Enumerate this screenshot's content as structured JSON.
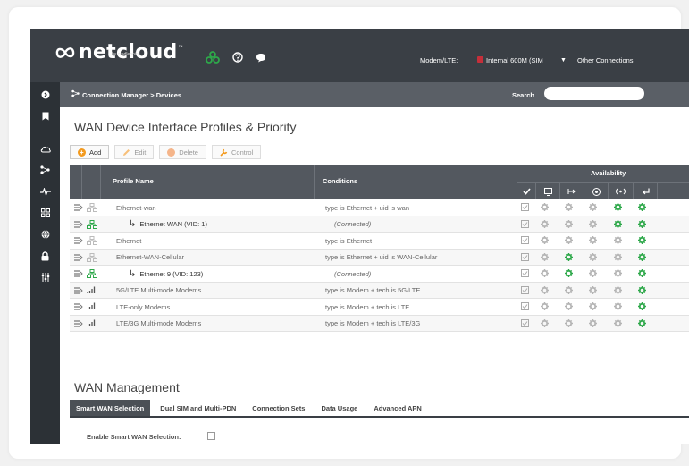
{
  "header": {
    "logo_text": "netcloud",
    "logo_tm": "™",
    "logo_by": "by cradlepoint",
    "modem_label": "Modem/LTE:",
    "modem_value": "Internal 600M (SIM",
    "other_connections": "Other Connections:"
  },
  "colors": {
    "header_bg": "#3a3f45",
    "nav_bg": "#2c3136",
    "crumb_bg": "#5a5f66",
    "accent_green": "#2ea84a",
    "add_orange": "#f39a1e"
  },
  "nav_icons": [
    "chevron-right-circle-icon",
    "bookmark-icon",
    "cloud-icon",
    "network-icon",
    "activity-icon",
    "grid-icon",
    "globe-icon",
    "lock-icon",
    "sliders-icon"
  ],
  "breadcrumb": {
    "text": "Connection Manager > Devices",
    "search_label": "Search"
  },
  "main": {
    "title": "WAN Device Interface Profiles & Priority",
    "toolbar": {
      "add": "Add",
      "edit": "Edit",
      "delete": "Delete",
      "control": "Control"
    },
    "table": {
      "col_profile": "Profile Name",
      "col_conditions": "Conditions",
      "col_availability": "Availability",
      "rows": [
        {
          "name": "Ethernet-wan",
          "cond": "type is Ethernet + uid is wan",
          "kind": "eth",
          "child": false,
          "avail": [
            "c",
            "g",
            "g",
            "g",
            "G",
            "G"
          ]
        },
        {
          "name": "Ethernet WAN (VID: 1)",
          "cond": "(Connected)",
          "kind": "ethg",
          "child": true,
          "avail": [
            "c",
            "g",
            "g",
            "g",
            "G",
            "G"
          ]
        },
        {
          "name": "Ethernet",
          "cond": "type is Ethernet",
          "kind": "eth",
          "child": false,
          "avail": [
            "c",
            "g",
            "g",
            "g",
            "g",
            "G"
          ]
        },
        {
          "name": "Ethernet-WAN-Cellular",
          "cond": "type is Ethernet + uid is WAN-Cellular",
          "kind": "eth",
          "child": false,
          "avail": [
            "c",
            "g",
            "G",
            "g",
            "g",
            "G"
          ]
        },
        {
          "name": "Ethernet 9 (VID: 123)",
          "cond": "(Connected)",
          "kind": "ethg",
          "child": true,
          "avail": [
            "c",
            "g",
            "G",
            "g",
            "g",
            "G"
          ]
        },
        {
          "name": "5G/LTE Multi-mode Modems",
          "cond": "type is Modem + tech is 5G/LTE",
          "kind": "cell",
          "child": false,
          "avail": [
            "c",
            "g",
            "g",
            "g",
            "g",
            "G"
          ]
        },
        {
          "name": "LTE-only Modems",
          "cond": "type is Modem + tech is LTE",
          "kind": "cell",
          "child": false,
          "avail": [
            "c",
            "g",
            "g",
            "g",
            "g",
            "G"
          ]
        },
        {
          "name": "LTE/3G Multi-mode Modems",
          "cond": "type is Modem + tech is LTE/3G",
          "kind": "cell",
          "child": false,
          "avail": [
            "c",
            "g",
            "g",
            "g",
            "g",
            "G"
          ]
        }
      ]
    }
  },
  "wan_management": {
    "title": "WAN Management",
    "tabs": [
      "Smart WAN Selection",
      "Dual SIM and Multi-PDN",
      "Connection Sets",
      "Data Usage",
      "Advanced APN"
    ],
    "smart_label": "Enable Smart WAN Selection:"
  }
}
